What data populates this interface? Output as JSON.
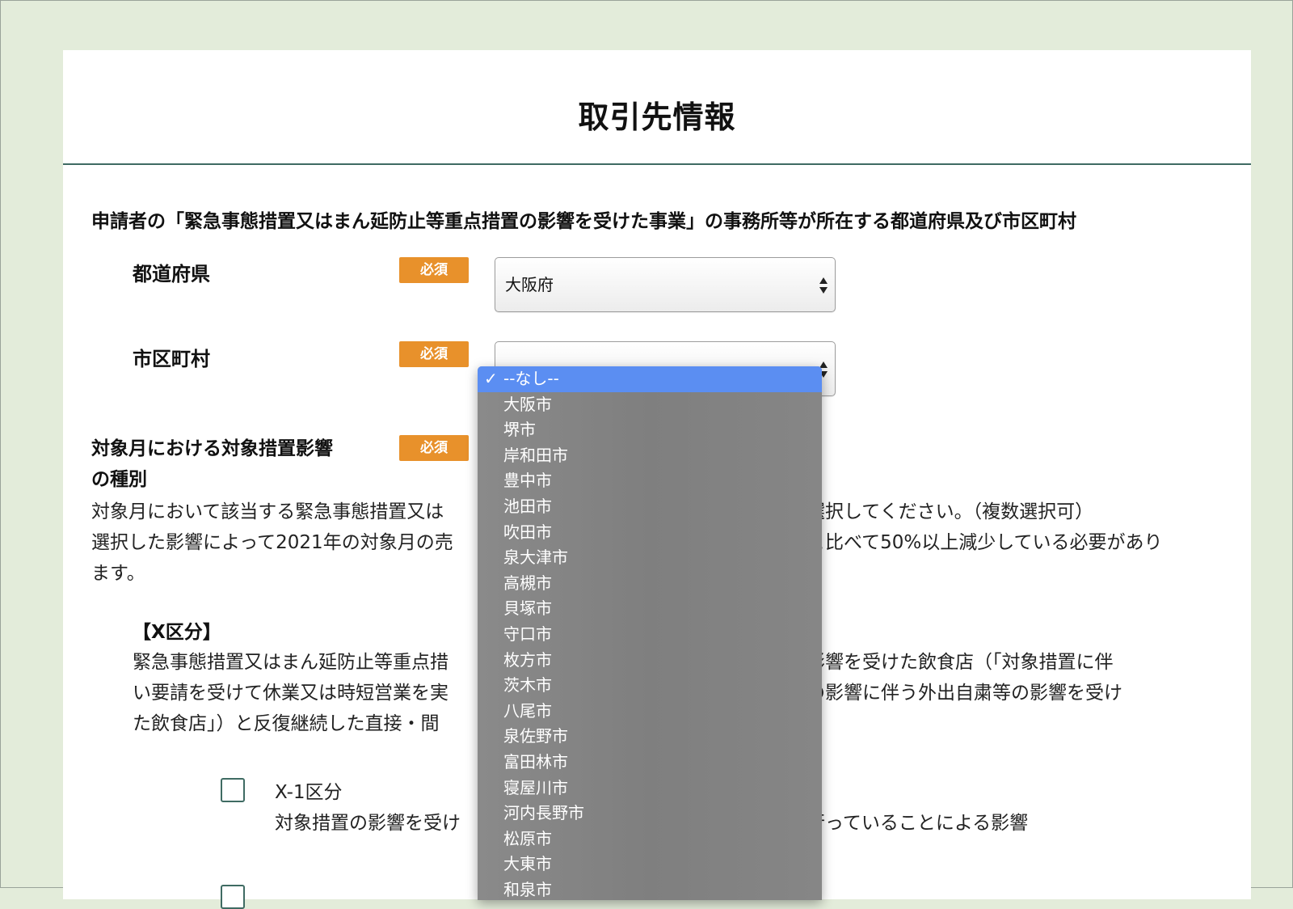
{
  "page": {
    "title": "取引先情報",
    "section_heading": "申請者の「緊急事態措置又はまん延防止等重点措置の影響を受けた事業」の事務所等が所在する都道府県及び市区町村"
  },
  "fields": {
    "prefecture": {
      "label": "都道府県",
      "badge": "必須",
      "value": "大阪府"
    },
    "city": {
      "label": "市区町村",
      "badge": "必須",
      "value": ""
    },
    "impact_type": {
      "label_line1": "対象月における対象措置影響",
      "label_line2": "の種別",
      "badge": "必須"
    }
  },
  "description": {
    "line1_left": "対象月において該当する緊急事態措置又は",
    "line1_right": "選択してください。（複数選択可）",
    "line2_left": "選択した影響によって2021年の対象月の売",
    "line2_right": "と比べて50%以上減少している必要があり",
    "line3": "ます。"
  },
  "x_section": {
    "heading": "【X区分】",
    "line1_left": "緊急事態措置又はまん延防止等重点措",
    "line1_right": "影響を受けた飲食店（「対象措置に伴",
    "line2_left": "い要請を受けて休業又は時短営業を実",
    "line2_right": "の影響に伴う外出自粛等の影響を受け",
    "line3_left": "た飲食店」）と反復継続した直接・間",
    "option1_title": "X-1区分",
    "option1_desc_left": "対象措置の影響を受け",
    "option1_desc_right": "行っていることによる影響"
  },
  "dropdown": {
    "selected_index": 0,
    "check_glyph": "✓",
    "items": [
      "--なし--",
      "大阪市",
      "堺市",
      "岸和田市",
      "豊中市",
      "池田市",
      "吹田市",
      "泉大津市",
      "高槻市",
      "貝塚市",
      "守口市",
      "枚方市",
      "茨木市",
      "八尾市",
      "泉佐野市",
      "富田林市",
      "寝屋川市",
      "河内長野市",
      "松原市",
      "大東市",
      "和泉市"
    ]
  },
  "colors": {
    "background": "#e3ecda",
    "accent": "#3f6b63",
    "badge": "#e8912b",
    "menu_highlight": "#5b8ef2",
    "menu_bg": "#828282"
  }
}
